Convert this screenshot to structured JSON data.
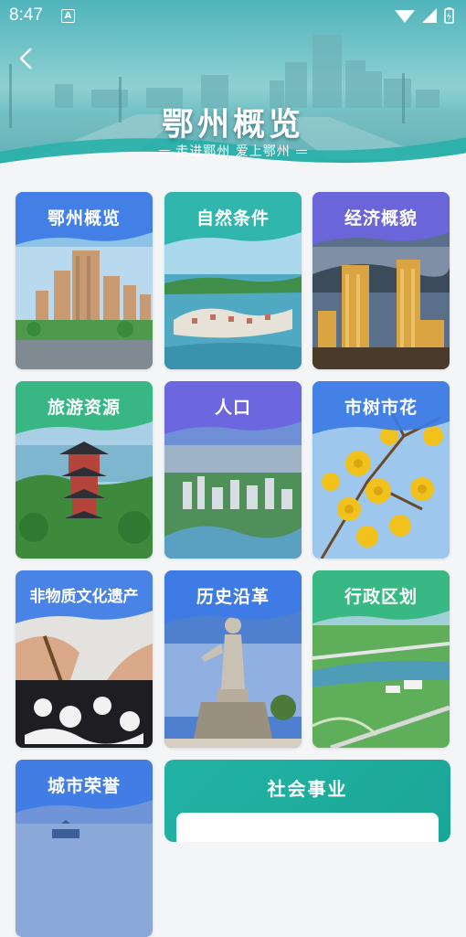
{
  "status_bar": {
    "time": "8:47",
    "notification_icon": "A"
  },
  "banner": {
    "title": "鄂州概览",
    "subtitle": "走进鄂州 爱上鄂州"
  },
  "cards": [
    {
      "label": "鄂州概览",
      "theme": "blue",
      "scene": "city-towers"
    },
    {
      "label": "自然条件",
      "theme": "teal",
      "scene": "lake-island"
    },
    {
      "label": "经济概貌",
      "theme": "purple",
      "scene": "night-towers"
    },
    {
      "label": "旅游资源",
      "theme": "green",
      "scene": "pagoda"
    },
    {
      "label": "人口",
      "theme": "purple",
      "scene": "aerial-city"
    },
    {
      "label": "市树市花",
      "theme": "blue",
      "scene": "yellow-flowers"
    },
    {
      "label": "非物质文化遗产",
      "theme": "blue",
      "scene": "paper-cutting"
    },
    {
      "label": "历史沿革",
      "theme": "blue",
      "scene": "statue"
    },
    {
      "label": "行政区划",
      "theme": "green",
      "scene": "river-bridge"
    },
    {
      "label": "城市荣誉",
      "theme": "blue",
      "scene": "city-skyline"
    }
  ],
  "social_card": {
    "label": "社会事业"
  },
  "colors": {
    "teal": "#26b3a6",
    "blue": "#3d7be6",
    "purple": "#6b64e0",
    "green": "#2fb57c"
  }
}
